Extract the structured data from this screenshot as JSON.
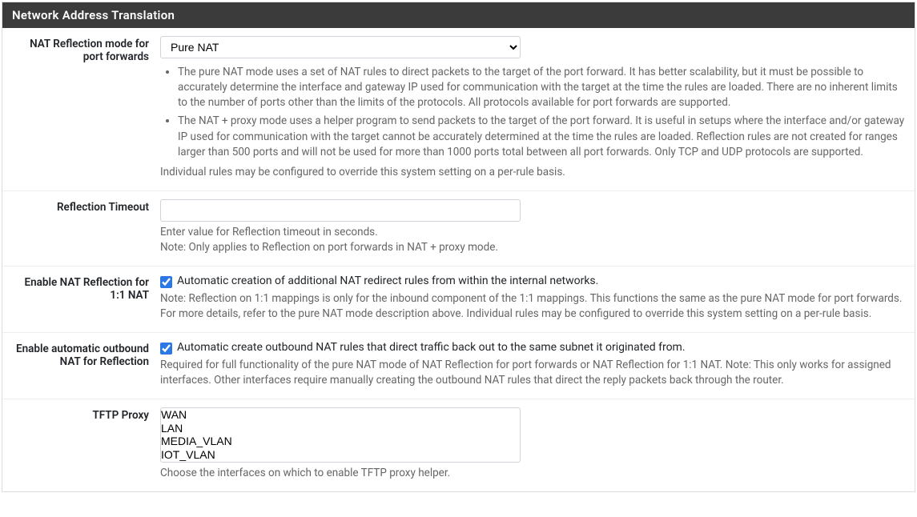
{
  "panel": {
    "title": "Network Address Translation"
  },
  "natReflection": {
    "label": "NAT Reflection mode for port forwards",
    "selected": "Pure NAT",
    "bullet1": "The pure NAT mode uses a set of NAT rules to direct packets to the target of the port forward. It has better scalability, but it must be possible to accurately determine the interface and gateway IP used for communication with the target at the time the rules are loaded. There are no inherent limits to the number of ports other than the limits of the protocols. All protocols available for port forwards are supported.",
    "bullet2": "The NAT + proxy mode uses a helper program to send packets to the target of the port forward. It is useful in setups where the interface and/or gateway IP used for communication with the target cannot be accurately determined at the time the rules are loaded. Reflection rules are not created for ranges larger than 500 ports and will not be used for more than 1000 ports total between all port forwards. Only TCP and UDP protocols are supported.",
    "note": "Individual rules may be configured to override this system setting on a per-rule basis."
  },
  "reflectionTimeout": {
    "label": "Reflection Timeout",
    "value": "",
    "help1": "Enter value for Reflection timeout in seconds.",
    "help2": "Note: Only applies to Reflection on port forwards in NAT + proxy mode."
  },
  "enable11": {
    "label": "Enable NAT Reflection for 1:1 NAT",
    "checked": true,
    "checkboxLabel": "Automatic creation of additional NAT redirect rules from within the internal networks.",
    "help": "Note: Reflection on 1:1 mappings is only for the inbound component of the 1:1 mappings. This functions the same as the pure NAT mode for port forwards. For more details, refer to the pure NAT mode description above. Individual rules may be configured to override this system setting on a per-rule basis."
  },
  "enableOutbound": {
    "label": "Enable automatic outbound NAT for Reflection",
    "checked": true,
    "checkboxLabel": "Automatic create outbound NAT rules that direct traffic back out to the same subnet it originated from.",
    "help": "Required for full functionality of the pure NAT mode of NAT Reflection for port forwards or NAT Reflection for 1:1 NAT. Note: This only works for assigned interfaces. Other interfaces require manually creating the outbound NAT rules that direct the reply packets back through the router."
  },
  "tftp": {
    "label": "TFTP Proxy",
    "options": [
      "WAN",
      "LAN",
      "MEDIA_VLAN",
      "IOT_VLAN"
    ],
    "help": "Choose the interfaces on which to enable TFTP proxy helper."
  }
}
